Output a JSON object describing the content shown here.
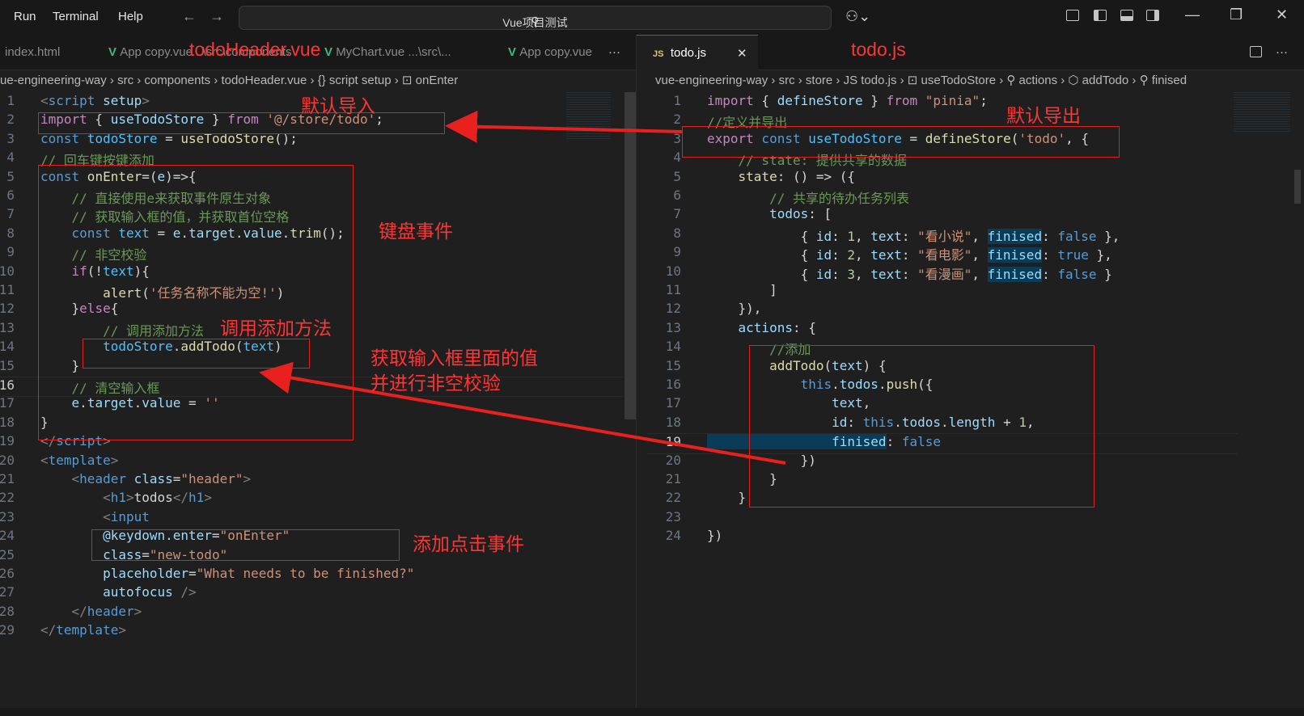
{
  "menu": [
    "Run",
    "Terminal",
    "Help"
  ],
  "search": {
    "label": "Vue项目测试"
  },
  "tabs_left": [
    {
      "label": "index.html"
    },
    {
      "label": "App copy.vue   ..\\src\\components",
      "active": false
    },
    {
      "label": "MyChart.vue   ...\\src\\...",
      "active": false
    },
    {
      "label": "App copy.vue",
      "active": false
    }
  ],
  "tab_more": "···",
  "tab_right": {
    "label": "todo.js",
    "badge": "JS",
    "close": "✕"
  },
  "crumbs_left": "ue-engineering-way  ›  src  ›  components  ›    todoHeader.vue  ›  {} script setup  ›  ⊡ onEnter",
  "crumbs_right": "vue-engineering-way  ›  src  ›  store  ›  JS  todo.js  ›  ⊡ useTodoStore  ›  ⚲ actions  ›  ⬡ addTodo  ›  ⚲ finised",
  "annotations": {
    "header_file": "todoHeader.vue",
    "default_import": "默认导入",
    "keyboard_event": "键盘事件",
    "call_add_method": "调用添加方法",
    "get_input_value": "获取输入框里面的值",
    "validate_nonempty": "并进行非空校验",
    "add_click_event": "添加点击事件",
    "todo_file": "todo.js",
    "default_export": "默认导出"
  },
  "left_code": [
    {
      "n": "1",
      "segs": [
        {
          "t": "<",
          "c": "#808080"
        },
        {
          "t": "script",
          "c": "#569cd6"
        },
        {
          "t": " setup",
          "c": "#9cdcfe"
        },
        {
          "t": ">",
          "c": "#808080"
        }
      ]
    },
    {
      "n": "2",
      "segs": [
        {
          "t": "import",
          "c": "#c586c0"
        },
        {
          "t": " { ",
          "c": "#d4d4d4"
        },
        {
          "t": "useTodoStore",
          "c": "#9cdcfe"
        },
        {
          "t": " } ",
          "c": "#d4d4d4"
        },
        {
          "t": "from",
          "c": "#c586c0"
        },
        {
          "t": " ",
          "c": "#d4d4d4"
        },
        {
          "t": "'@/store/todo'",
          "c": "#ce9178"
        },
        {
          "t": ";",
          "c": "#d4d4d4"
        }
      ]
    },
    {
      "n": "3",
      "segs": [
        {
          "t": "const",
          "c": "#569cd6"
        },
        {
          "t": " todoStore",
          "c": "#4fc1ff"
        },
        {
          "t": " = ",
          "c": "#d4d4d4"
        },
        {
          "t": "useTodoStore",
          "c": "#dcdcaa"
        },
        {
          "t": "();",
          "c": "#d4d4d4"
        }
      ]
    },
    {
      "n": "4",
      "segs": [
        {
          "t": "// 回车键按键添加",
          "c": "#6a9955"
        }
      ]
    },
    {
      "n": "5",
      "segs": [
        {
          "t": "const",
          "c": "#569cd6"
        },
        {
          "t": " onEnter",
          "c": "#dcdcaa"
        },
        {
          "t": "=(",
          "c": "#d4d4d4"
        },
        {
          "t": "e",
          "c": "#9cdcfe"
        },
        {
          "t": ")=>{",
          "c": "#d4d4d4"
        }
      ]
    },
    {
      "n": "6",
      "segs": [
        {
          "t": "    // 直接使用e来获取事件原生对象",
          "c": "#6a9955"
        }
      ]
    },
    {
      "n": "7",
      "segs": [
        {
          "t": "    // 获取输入框的值，并获取首位空格",
          "c": "#6a9955"
        }
      ]
    },
    {
      "n": "8",
      "segs": [
        {
          "t": "    const",
          "c": "#569cd6"
        },
        {
          "t": " text",
          "c": "#4fc1ff"
        },
        {
          "t": " = ",
          "c": "#d4d4d4"
        },
        {
          "t": "e",
          "c": "#9cdcfe"
        },
        {
          "t": ".",
          "c": "#d4d4d4"
        },
        {
          "t": "target",
          "c": "#9cdcfe"
        },
        {
          "t": ".",
          "c": "#d4d4d4"
        },
        {
          "t": "value",
          "c": "#9cdcfe"
        },
        {
          "t": ".",
          "c": "#d4d4d4"
        },
        {
          "t": "trim",
          "c": "#dcdcaa"
        },
        {
          "t": "();",
          "c": "#d4d4d4"
        }
      ]
    },
    {
      "n": "9",
      "segs": [
        {
          "t": "    // 非空校验",
          "c": "#6a9955"
        }
      ]
    },
    {
      "n": "10",
      "segs": [
        {
          "t": "    if",
          "c": "#c586c0"
        },
        {
          "t": "(!",
          "c": "#d4d4d4"
        },
        {
          "t": "text",
          "c": "#4fc1ff"
        },
        {
          "t": "){",
          "c": "#d4d4d4"
        }
      ]
    },
    {
      "n": "11",
      "segs": [
        {
          "t": "        alert",
          "c": "#dcdcaa"
        },
        {
          "t": "(",
          "c": "#d4d4d4"
        },
        {
          "t": "'任务名称不能为空!'",
          "c": "#ce9178"
        },
        {
          "t": ")",
          "c": "#d4d4d4"
        }
      ]
    },
    {
      "n": "12",
      "segs": [
        {
          "t": "    }",
          "c": "#d4d4d4"
        },
        {
          "t": "else",
          "c": "#c586c0"
        },
        {
          "t": "{",
          "c": "#d4d4d4"
        }
      ]
    },
    {
      "n": "13",
      "segs": [
        {
          "t": "        // 调用添加方法",
          "c": "#6a9955"
        }
      ]
    },
    {
      "n": "14",
      "segs": [
        {
          "t": "        todoStore",
          "c": "#4fc1ff"
        },
        {
          "t": ".",
          "c": "#d4d4d4"
        },
        {
          "t": "addTodo",
          "c": "#dcdcaa"
        },
        {
          "t": "(",
          "c": "#d4d4d4"
        },
        {
          "t": "text",
          "c": "#4fc1ff"
        },
        {
          "t": ")",
          "c": "#d4d4d4"
        }
      ]
    },
    {
      "n": "15",
      "segs": [
        {
          "t": "    }",
          "c": "#d4d4d4"
        }
      ]
    },
    {
      "n": "16",
      "segs": [
        {
          "t": "    // 清空输入框",
          "c": "#6a9955"
        }
      ]
    },
    {
      "n": "17",
      "segs": [
        {
          "t": "    e",
          "c": "#9cdcfe"
        },
        {
          "t": ".",
          "c": "#d4d4d4"
        },
        {
          "t": "target",
          "c": "#9cdcfe"
        },
        {
          "t": ".",
          "c": "#d4d4d4"
        },
        {
          "t": "value",
          "c": "#9cdcfe"
        },
        {
          "t": " = ",
          "c": "#d4d4d4"
        },
        {
          "t": "''",
          "c": "#ce9178"
        }
      ]
    },
    {
      "n": "18",
      "segs": [
        {
          "t": "}",
          "c": "#d4d4d4"
        }
      ]
    },
    {
      "n": "19",
      "segs": [
        {
          "t": "</",
          "c": "#808080"
        },
        {
          "t": "script",
          "c": "#569cd6"
        },
        {
          "t": ">",
          "c": "#808080"
        }
      ]
    },
    {
      "n": "20",
      "segs": [
        {
          "t": "<",
          "c": "#808080"
        },
        {
          "t": "template",
          "c": "#569cd6"
        },
        {
          "t": ">",
          "c": "#808080"
        }
      ]
    },
    {
      "n": "21",
      "segs": [
        {
          "t": "    <",
          "c": "#808080"
        },
        {
          "t": "header",
          "c": "#569cd6"
        },
        {
          "t": " class",
          "c": "#9cdcfe"
        },
        {
          "t": "=",
          "c": "#d4d4d4"
        },
        {
          "t": "\"header\"",
          "c": "#ce9178"
        },
        {
          "t": ">",
          "c": "#808080"
        }
      ]
    },
    {
      "n": "22",
      "segs": [
        {
          "t": "        <",
          "c": "#808080"
        },
        {
          "t": "h1",
          "c": "#569cd6"
        },
        {
          "t": ">",
          "c": "#808080"
        },
        {
          "t": "todos",
          "c": "#d4d4d4"
        },
        {
          "t": "</",
          "c": "#808080"
        },
        {
          "t": "h1",
          "c": "#569cd6"
        },
        {
          "t": ">",
          "c": "#808080"
        }
      ]
    },
    {
      "n": "23",
      "segs": [
        {
          "t": "        <",
          "c": "#808080"
        },
        {
          "t": "input",
          "c": "#569cd6"
        }
      ]
    },
    {
      "n": "24",
      "segs": [
        {
          "t": "        @keydown.enter",
          "c": "#9cdcfe"
        },
        {
          "t": "=",
          "c": "#d4d4d4"
        },
        {
          "t": "\"onEnter\"",
          "c": "#ce9178"
        }
      ]
    },
    {
      "n": "25",
      "segs": [
        {
          "t": "        class",
          "c": "#9cdcfe"
        },
        {
          "t": "=",
          "c": "#d4d4d4"
        },
        {
          "t": "\"new-todo\"",
          "c": "#ce9178"
        }
      ]
    },
    {
      "n": "26",
      "segs": [
        {
          "t": "        placeholder",
          "c": "#9cdcfe"
        },
        {
          "t": "=",
          "c": "#d4d4d4"
        },
        {
          "t": "\"What needs to be finished?\"",
          "c": "#ce9178"
        }
      ]
    },
    {
      "n": "27",
      "segs": [
        {
          "t": "        autofocus",
          "c": "#9cdcfe"
        },
        {
          "t": " />",
          "c": "#808080"
        }
      ]
    },
    {
      "n": "28",
      "segs": [
        {
          "t": "    </",
          "c": "#808080"
        },
        {
          "t": "header",
          "c": "#569cd6"
        },
        {
          "t": ">",
          "c": "#808080"
        }
      ]
    },
    {
      "n": "29",
      "segs": [
        {
          "t": "</",
          "c": "#808080"
        },
        {
          "t": "template",
          "c": "#569cd6"
        },
        {
          "t": ">",
          "c": "#808080"
        }
      ]
    }
  ],
  "right_code": [
    {
      "n": "1",
      "segs": [
        {
          "t": "import",
          "c": "#c586c0"
        },
        {
          "t": " { ",
          "c": "#d4d4d4"
        },
        {
          "t": "defineStore",
          "c": "#9cdcfe"
        },
        {
          "t": " } ",
          "c": "#d4d4d4"
        },
        {
          "t": "from",
          "c": "#c586c0"
        },
        {
          "t": " ",
          "c": "#d4d4d4"
        },
        {
          "t": "\"pinia\"",
          "c": "#ce9178"
        },
        {
          "t": ";",
          "c": "#d4d4d4"
        }
      ]
    },
    {
      "n": "2",
      "segs": [
        {
          "t": "//定义并导出",
          "c": "#6a9955"
        }
      ]
    },
    {
      "n": "3",
      "segs": [
        {
          "t": "export",
          "c": "#c586c0"
        },
        {
          "t": " const",
          "c": "#569cd6"
        },
        {
          "t": " useTodoStore",
          "c": "#4fc1ff"
        },
        {
          "t": " = ",
          "c": "#d4d4d4"
        },
        {
          "t": "defineStore",
          "c": "#dcdcaa"
        },
        {
          "t": "(",
          "c": "#d4d4d4"
        },
        {
          "t": "'todo'",
          "c": "#ce9178"
        },
        {
          "t": ", {",
          "c": "#d4d4d4"
        }
      ]
    },
    {
      "n": "4",
      "segs": [
        {
          "t": "    // state: 提供共享的数据",
          "c": "#6a9955"
        }
      ]
    },
    {
      "n": "5",
      "segs": [
        {
          "t": "    state",
          "c": "#dcdcaa"
        },
        {
          "t": ": () => ({",
          "c": "#d4d4d4"
        }
      ]
    },
    {
      "n": "6",
      "segs": [
        {
          "t": "        // 共享的待办任务列表",
          "c": "#6a9955"
        }
      ]
    },
    {
      "n": "7",
      "segs": [
        {
          "t": "        todos",
          "c": "#9cdcfe"
        },
        {
          "t": ": [",
          "c": "#d4d4d4"
        }
      ]
    },
    {
      "n": "8",
      "segs": [
        {
          "t": "            { ",
          "c": "#d4d4d4"
        },
        {
          "t": "id",
          "c": "#9cdcfe"
        },
        {
          "t": ": ",
          "c": "#d4d4d4"
        },
        {
          "t": "1",
          "c": "#b5cea8"
        },
        {
          "t": ", ",
          "c": "#d4d4d4"
        },
        {
          "t": "text",
          "c": "#9cdcfe"
        },
        {
          "t": ": ",
          "c": "#d4d4d4"
        },
        {
          "t": "\"看小说\"",
          "c": "#ce9178"
        },
        {
          "t": ", ",
          "c": "#d4d4d4"
        },
        {
          "t": "finised",
          "c": "#9cdcfe",
          "hl": true
        },
        {
          "t": ": ",
          "c": "#d4d4d4"
        },
        {
          "t": "false",
          "c": "#569cd6"
        },
        {
          "t": " },",
          "c": "#d4d4d4"
        }
      ]
    },
    {
      "n": "9",
      "segs": [
        {
          "t": "            { ",
          "c": "#d4d4d4"
        },
        {
          "t": "id",
          "c": "#9cdcfe"
        },
        {
          "t": ": ",
          "c": "#d4d4d4"
        },
        {
          "t": "2",
          "c": "#b5cea8"
        },
        {
          "t": ", ",
          "c": "#d4d4d4"
        },
        {
          "t": "text",
          "c": "#9cdcfe"
        },
        {
          "t": ": ",
          "c": "#d4d4d4"
        },
        {
          "t": "\"看电影\"",
          "c": "#ce9178"
        },
        {
          "t": ", ",
          "c": "#d4d4d4"
        },
        {
          "t": "finised",
          "c": "#9cdcfe",
          "hl": true
        },
        {
          "t": ": ",
          "c": "#d4d4d4"
        },
        {
          "t": "true",
          "c": "#569cd6"
        },
        {
          "t": " },",
          "c": "#d4d4d4"
        }
      ]
    },
    {
      "n": "10",
      "segs": [
        {
          "t": "            { ",
          "c": "#d4d4d4"
        },
        {
          "t": "id",
          "c": "#9cdcfe"
        },
        {
          "t": ": ",
          "c": "#d4d4d4"
        },
        {
          "t": "3",
          "c": "#b5cea8"
        },
        {
          "t": ", ",
          "c": "#d4d4d4"
        },
        {
          "t": "text",
          "c": "#9cdcfe"
        },
        {
          "t": ": ",
          "c": "#d4d4d4"
        },
        {
          "t": "\"看漫画\"",
          "c": "#ce9178"
        },
        {
          "t": ", ",
          "c": "#d4d4d4"
        },
        {
          "t": "finised",
          "c": "#9cdcfe",
          "hl": true
        },
        {
          "t": ": ",
          "c": "#d4d4d4"
        },
        {
          "t": "false",
          "c": "#569cd6"
        },
        {
          "t": " }",
          "c": "#d4d4d4"
        }
      ]
    },
    {
      "n": "11",
      "segs": [
        {
          "t": "        ]",
          "c": "#d4d4d4"
        }
      ]
    },
    {
      "n": "12",
      "segs": [
        {
          "t": "    }),",
          "c": "#d4d4d4"
        }
      ]
    },
    {
      "n": "13",
      "segs": [
        {
          "t": "    actions",
          "c": "#9cdcfe"
        },
        {
          "t": ": {",
          "c": "#d4d4d4"
        }
      ]
    },
    {
      "n": "14",
      "segs": [
        {
          "t": "        //添加",
          "c": "#6a9955"
        }
      ]
    },
    {
      "n": "15",
      "segs": [
        {
          "t": "        addTodo",
          "c": "#dcdcaa"
        },
        {
          "t": "(",
          "c": "#d4d4d4"
        },
        {
          "t": "text",
          "c": "#9cdcfe"
        },
        {
          "t": ") {",
          "c": "#d4d4d4"
        }
      ]
    },
    {
      "n": "16",
      "segs": [
        {
          "t": "            this",
          "c": "#569cd6"
        },
        {
          "t": ".",
          "c": "#d4d4d4"
        },
        {
          "t": "todos",
          "c": "#9cdcfe"
        },
        {
          "t": ".",
          "c": "#d4d4d4"
        },
        {
          "t": "push",
          "c": "#dcdcaa"
        },
        {
          "t": "({",
          "c": "#d4d4d4"
        }
      ]
    },
    {
      "n": "17",
      "segs": [
        {
          "t": "                text",
          "c": "#9cdcfe"
        },
        {
          "t": ",",
          "c": "#d4d4d4"
        }
      ]
    },
    {
      "n": "18",
      "segs": [
        {
          "t": "                id",
          "c": "#9cdcfe"
        },
        {
          "t": ": ",
          "c": "#d4d4d4"
        },
        {
          "t": "this",
          "c": "#569cd6"
        },
        {
          "t": ".",
          "c": "#d4d4d4"
        },
        {
          "t": "todos",
          "c": "#9cdcfe"
        },
        {
          "t": ".",
          "c": "#d4d4d4"
        },
        {
          "t": "length",
          "c": "#9cdcfe"
        },
        {
          "t": " + ",
          "c": "#d4d4d4"
        },
        {
          "t": "1",
          "c": "#b5cea8"
        },
        {
          "t": ",",
          "c": "#d4d4d4"
        }
      ]
    },
    {
      "n": "19",
      "segs": [
        {
          "t": "                finised",
          "c": "#9cdcfe",
          "hl": true
        },
        {
          "t": ": ",
          "c": "#d4d4d4"
        },
        {
          "t": "false",
          "c": "#569cd6"
        }
      ]
    },
    {
      "n": "20",
      "segs": [
        {
          "t": "            })",
          "c": "#d4d4d4"
        }
      ]
    },
    {
      "n": "21",
      "segs": [
        {
          "t": "        }",
          "c": "#d4d4d4"
        }
      ]
    },
    {
      "n": "22",
      "segs": [
        {
          "t": "    }",
          "c": "#d4d4d4"
        }
      ]
    },
    {
      "n": "23",
      "segs": []
    },
    {
      "n": "24",
      "segs": [
        {
          "t": "})",
          "c": "#d4d4d4"
        }
      ]
    }
  ]
}
